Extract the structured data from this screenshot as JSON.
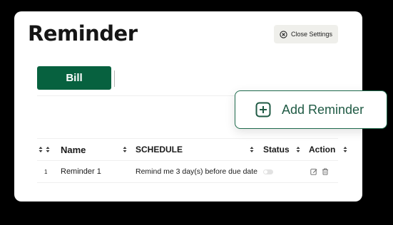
{
  "page": {
    "title": "Reminder"
  },
  "header": {
    "close_settings_label": "Close Settings",
    "close_icon": "close-circle-icon"
  },
  "tabs": [
    {
      "label": "Bill",
      "active": true
    }
  ],
  "add_reminder": {
    "label": "Add Reminder",
    "icon": "plus-square-icon"
  },
  "table": {
    "columns": [
      "Name",
      "SCHEDULE",
      "Status",
      "Action"
    ],
    "rows": [
      {
        "index": "1",
        "name": "Reminder 1",
        "schedule": "Remind me 3 day(s) before due date",
        "status": false
      }
    ]
  },
  "colors": {
    "brand_green": "#07613f",
    "accent_green": "#1e6a4c",
    "close_button_bg": "#efefeb"
  }
}
